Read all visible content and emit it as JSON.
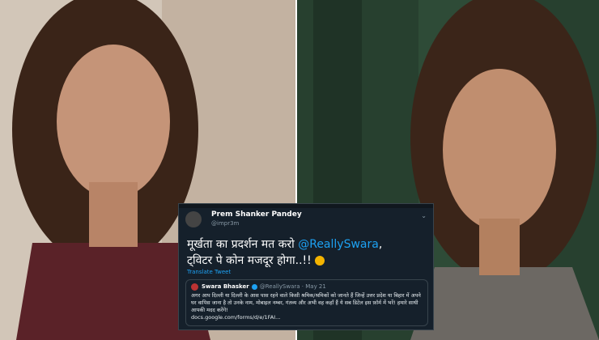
{
  "tweet": {
    "author_name": "Prem Shanker Pandey",
    "author_handle": "@impr3m",
    "body_line1": "मूर्खता का प्रदर्शन मत करो ",
    "mention": "@ReallySwara",
    "body_line1_end": ",",
    "body_line2": "ट्विटर पे कोन मजदूर होगा..!!",
    "translate_label": "Translate Tweet"
  },
  "quoted": {
    "author_name": "Swara Bhasker",
    "author_handle": "@ReallySwara",
    "date": "May 21",
    "text": "अगर आप दिल्ली या दिल्ली के आस पास रहने वाले किसी श्रमिक/श्रमिकों को जानते हैं जिन्हें उत्तर प्रदेश या बिहार में अपने घर वापिस जाना है तो उनके नाम, मोबाइल नम्बर, गंतव्य और अभी वह कहाँ हैं ये सब डिटेल इस फ़ॉर्म में भरें! हमारे साथी आपकी मदद करेंगे!",
    "link": "docs.google.com/forms/d/e/1FAI..."
  }
}
